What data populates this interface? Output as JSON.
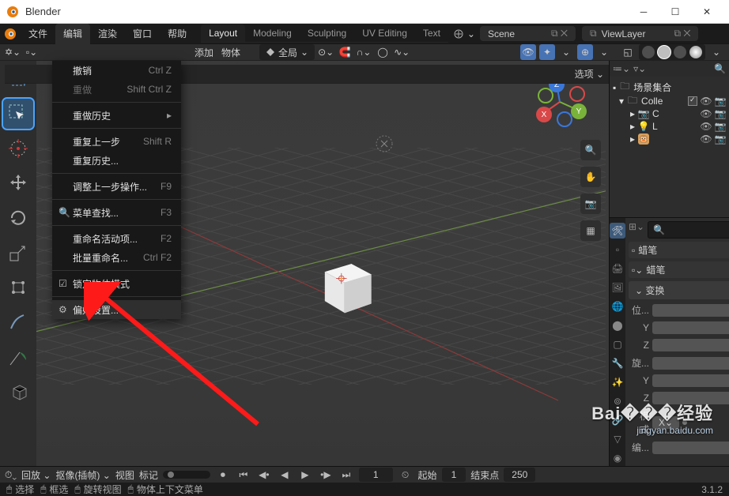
{
  "window": {
    "title": "Blender"
  },
  "topmenu": {
    "items": [
      "文件",
      "编辑",
      "渲染",
      "窗口",
      "帮助"
    ],
    "active": 1
  },
  "wtabs": {
    "items": [
      "Layout",
      "Modeling",
      "Sculpting",
      "UV Editing",
      "Text"
    ],
    "active": 0
  },
  "scene": {
    "label": "Scene"
  },
  "viewlayer": {
    "label": "ViewLayer"
  },
  "hdr": {
    "add": "添加",
    "object": "物体",
    "global": "全局",
    "options": "选项",
    "opt_caret": "⌄"
  },
  "edit_menu": {
    "items": [
      {
        "label": "撤销",
        "shortcut": "Ctrl Z",
        "disabled": false
      },
      {
        "label": "重做",
        "shortcut": "Shift Ctrl Z",
        "disabled": true
      },
      {
        "sep": true
      },
      {
        "label": "重做历史",
        "arrow": true
      },
      {
        "sep": true
      },
      {
        "label": "重复上一步",
        "shortcut": "Shift R"
      },
      {
        "label": "重复历史..."
      },
      {
        "sep": true
      },
      {
        "label": "调整上一步操作...",
        "shortcut": "F9"
      },
      {
        "sep": true
      },
      {
        "label": "菜单查找...",
        "shortcut": "F3",
        "icon": "🔍"
      },
      {
        "sep": true
      },
      {
        "label": "重命名活动项...",
        "shortcut": "F2"
      },
      {
        "label": "批量重命名...",
        "shortcut": "Ctrl F2"
      },
      {
        "sep": true
      },
      {
        "label": "锁定物体模式",
        "icon": "☑"
      },
      {
        "sep": true
      },
      {
        "label": "偏好设置...",
        "icon": "⚙",
        "hl": true
      }
    ]
  },
  "gizmo": {
    "x": "X",
    "y": "Y",
    "z": "Z"
  },
  "outliner": {
    "options": "选项",
    "root": "场景集合",
    "coll": "Colle",
    "rows": [
      {
        "icon": "📷",
        "name": "C",
        "color": "#d9a05b"
      },
      {
        "icon": "💡",
        "name": "L",
        "color": "#d9a05b"
      },
      {
        "icon": "🐵",
        "name": "",
        "bg": "#d9a05b"
      }
    ]
  },
  "properties": {
    "bc1": "蜡笔",
    "bc2": "蜡笔",
    "panel": "变换",
    "loc": "位...",
    "rot": "旋...",
    "mode": "模式",
    "modeval": "X⌄",
    "scale": "编...",
    "y": "Y",
    "z": "Z",
    "pin": "📌"
  },
  "timeline": {
    "playback": "回放",
    "keying": "抠像(插帧)",
    "view": "视图",
    "marker": "标记",
    "frame": "1",
    "start": "起始",
    "startval": "1",
    "end": "结束点",
    "endval": "250",
    "auto": "⏺"
  },
  "status": {
    "items": [
      "选择",
      "框选",
      "旋转视图",
      "物体上下文菜单"
    ],
    "version": "3.1.2"
  },
  "watermark": {
    "big": "Bai���经验",
    "small": "jingyan.baidu.com"
  }
}
